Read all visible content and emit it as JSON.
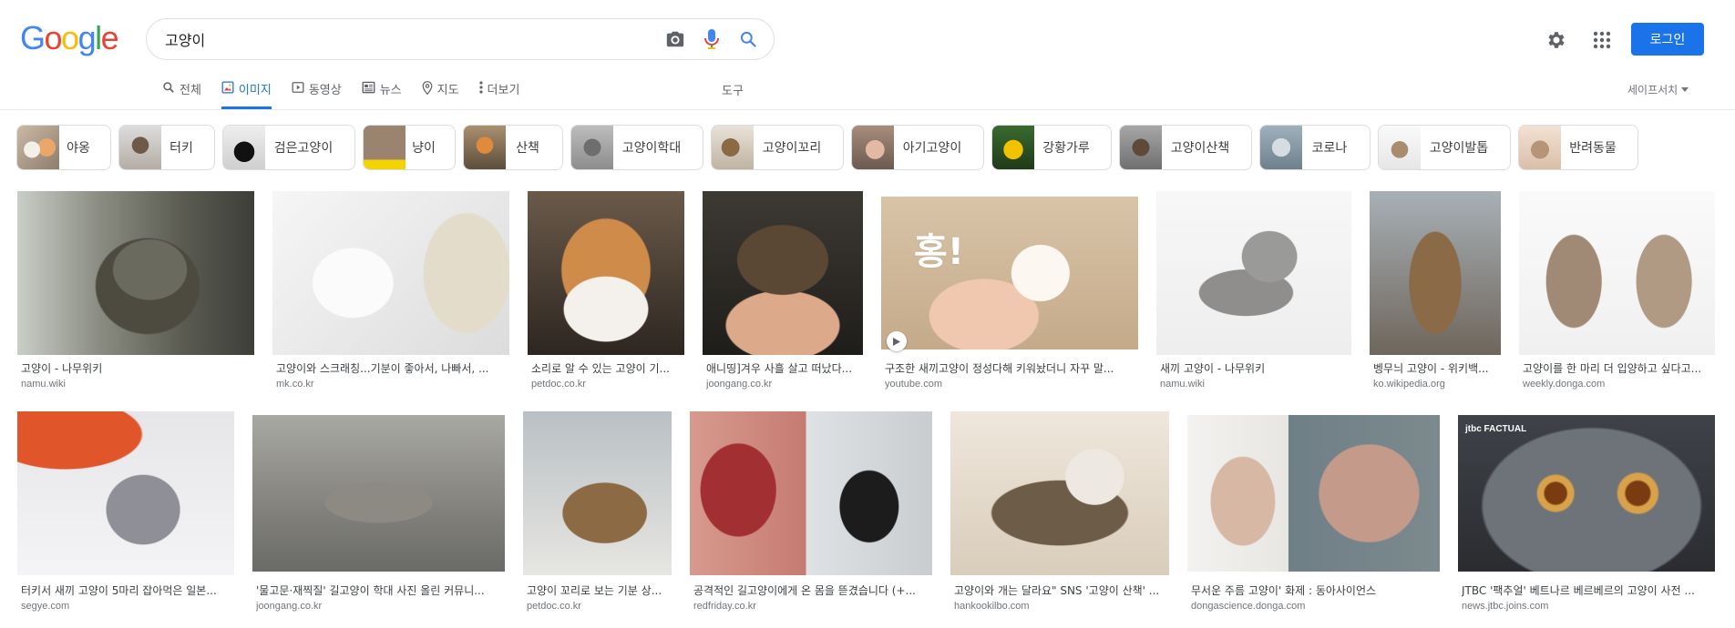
{
  "logo": {
    "letters": [
      "G",
      "o",
      "o",
      "g",
      "l",
      "e"
    ],
    "colors": [
      "#4285f4",
      "#ea4335",
      "#fbbc05",
      "#4285f4",
      "#34a853",
      "#ea4335"
    ]
  },
  "search": {
    "query": "고양이"
  },
  "header": {
    "login_label": "로그인"
  },
  "tabs": [
    {
      "label": "전체",
      "icon": "search-icon",
      "active": false
    },
    {
      "label": "이미지",
      "icon": "image-icon",
      "active": true
    },
    {
      "label": "동영상",
      "icon": "video-icon",
      "active": false
    },
    {
      "label": "뉴스",
      "icon": "news-icon",
      "active": false
    },
    {
      "label": "지도",
      "icon": "map-pin-icon",
      "active": false
    },
    {
      "label": "더보기",
      "icon": "more-vert-icon",
      "active": false
    }
  ],
  "tools_label": "도구",
  "safesearch_label": "세이프서치",
  "chips": [
    "야옹",
    "터키",
    "검은고양이",
    "냥이",
    "산책",
    "고양이학대",
    "고양이꼬리",
    "아기고양이",
    "강황가루",
    "고양이산책",
    "코로나",
    "고양이발톱",
    "반려동물"
  ],
  "results": [
    {
      "caption": "고양이 - 나무위키",
      "source": "namu.wiki"
    },
    {
      "caption": "고양이와 스크래칭...기분이 좋아서, 나빠서, ...",
      "source": "mk.co.kr"
    },
    {
      "caption": "소리로 알 수 있는 고양이 기...",
      "source": "petdoc.co.kr"
    },
    {
      "caption": "애니띵]겨우 사흘 살고 떠났다...",
      "source": "joongang.co.kr"
    },
    {
      "caption": "구조한 새끼고양이 정성다해 키워놨더니 자꾸 말...",
      "source": "youtube.com",
      "video": true,
      "overlay": "홍!"
    },
    {
      "caption": "새끼 고양이 - 나무위키",
      "source": "namu.wiki"
    },
    {
      "caption": "벵무늬 고양이 - 위키백...",
      "source": "ko.wikipedia.org"
    },
    {
      "caption": "고양이를 한 마리 더 입양하고 싶다고...",
      "source": "weekly.donga.com"
    },
    {
      "caption": "터키서 새끼 고양이 5마리 잡아먹은 일본...",
      "source": "segye.com"
    },
    {
      "caption": "'물고문·재찍질' 길고양이 학대 사진 올린 커뮤니...",
      "source": "joongang.co.kr"
    },
    {
      "caption": "고양이 꼬리로 보는 기분 상...",
      "source": "petdoc.co.kr"
    },
    {
      "caption": "공격적인 길고양이에게 온 몸을 뜯겼습니다 (+...",
      "source": "redfriday.co.kr"
    },
    {
      "caption": "고양이와 개는 달라요\" SNS '고양이 산책' ...",
      "source": "hankookilbo.com"
    },
    {
      "caption": "무서운 주름 고양이' 화제 : 동아사이언스",
      "source": "dongascience.donga.com"
    },
    {
      "caption": "JTBC '팩추얼' 베트나르 베르베르의 고양이 사전 ...",
      "source": "news.jtbc.joins.com",
      "overlay": "jtbc FACTUAL"
    }
  ]
}
